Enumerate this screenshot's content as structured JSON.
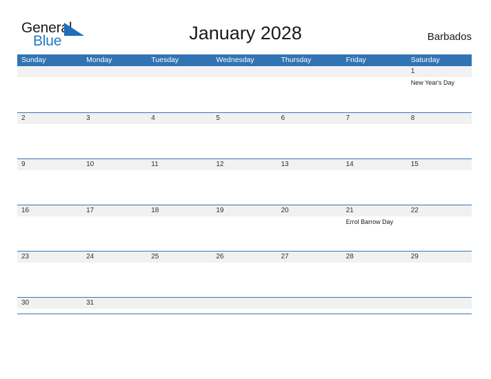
{
  "brand": {
    "name_part1": "General",
    "name_part2": "Blue",
    "flag_icon": "blue-triangle-flag-icon",
    "color_primary": "#1f7ac4",
    "color_text": "#1a1a1a"
  },
  "header": {
    "title": "January 2028",
    "locale": "Barbados"
  },
  "calendar": {
    "header_color": "#3074b4",
    "band_color": "#f1f1f1",
    "month": "January",
    "year": "2028",
    "weekday_headers": [
      "Sunday",
      "Monday",
      "Tuesday",
      "Wednesday",
      "Thursday",
      "Friday",
      "Saturday"
    ],
    "weeks": [
      {
        "days": [
          {
            "num": "",
            "events": []
          },
          {
            "num": "",
            "events": []
          },
          {
            "num": "",
            "events": []
          },
          {
            "num": "",
            "events": []
          },
          {
            "num": "",
            "events": []
          },
          {
            "num": "",
            "events": []
          },
          {
            "num": "1",
            "events": [
              "New Year's Day"
            ]
          }
        ]
      },
      {
        "days": [
          {
            "num": "2",
            "events": []
          },
          {
            "num": "3",
            "events": []
          },
          {
            "num": "4",
            "events": []
          },
          {
            "num": "5",
            "events": []
          },
          {
            "num": "6",
            "events": []
          },
          {
            "num": "7",
            "events": []
          },
          {
            "num": "8",
            "events": []
          }
        ]
      },
      {
        "days": [
          {
            "num": "9",
            "events": []
          },
          {
            "num": "10",
            "events": []
          },
          {
            "num": "11",
            "events": []
          },
          {
            "num": "12",
            "events": []
          },
          {
            "num": "13",
            "events": []
          },
          {
            "num": "14",
            "events": []
          },
          {
            "num": "15",
            "events": []
          }
        ]
      },
      {
        "days": [
          {
            "num": "16",
            "events": []
          },
          {
            "num": "17",
            "events": []
          },
          {
            "num": "18",
            "events": []
          },
          {
            "num": "19",
            "events": []
          },
          {
            "num": "20",
            "events": []
          },
          {
            "num": "21",
            "events": [
              "Errol Barrow Day"
            ]
          },
          {
            "num": "22",
            "events": []
          }
        ]
      },
      {
        "days": [
          {
            "num": "23",
            "events": []
          },
          {
            "num": "24",
            "events": []
          },
          {
            "num": "25",
            "events": []
          },
          {
            "num": "26",
            "events": []
          },
          {
            "num": "27",
            "events": []
          },
          {
            "num": "28",
            "events": []
          },
          {
            "num": "29",
            "events": []
          }
        ]
      },
      {
        "days": [
          {
            "num": "30",
            "events": []
          },
          {
            "num": "31",
            "events": []
          },
          {
            "num": "",
            "events": []
          },
          {
            "num": "",
            "events": []
          },
          {
            "num": "",
            "events": []
          },
          {
            "num": "",
            "events": []
          },
          {
            "num": "",
            "events": []
          }
        ]
      }
    ]
  }
}
